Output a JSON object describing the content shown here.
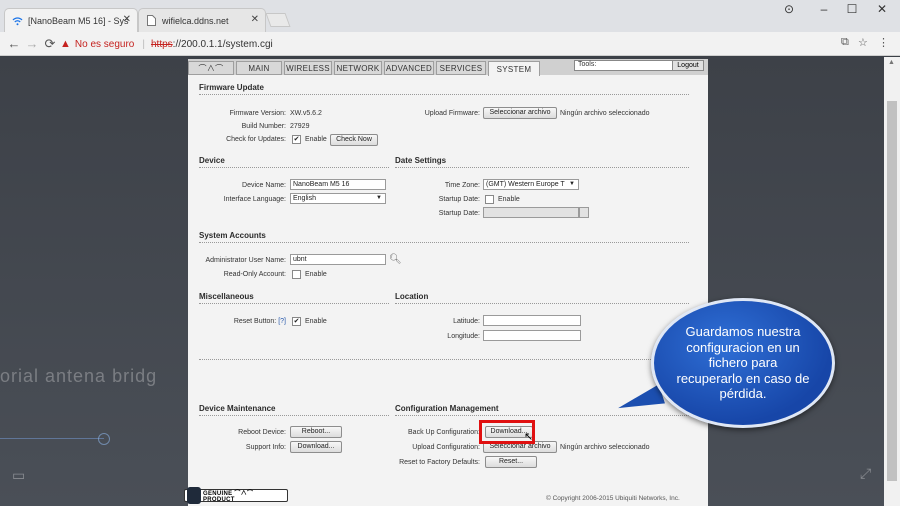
{
  "browser": {
    "tabs": [
      {
        "label": "[NanoBeam M5 16] - Sys",
        "icon": "wifi-icon"
      },
      {
        "label": "wifielca.ddns.net",
        "icon": "document-icon"
      }
    ],
    "window_controls": {
      "profile": "⊙",
      "minimize": "–",
      "maximize": "☐",
      "close": "✕"
    },
    "address": {
      "security_label": "No es seguro",
      "scheme": "https",
      "rest": "://200.0.1.1/system.cgi"
    }
  },
  "nav": {
    "logo": "⌒∧⌒",
    "tabs": [
      "MAIN",
      "WIRELESS",
      "NETWORK",
      "ADVANCED",
      "SERVICES",
      "SYSTEM"
    ],
    "active_tab": "SYSTEM",
    "tools_label": "Tools:",
    "logout_label": "Logout"
  },
  "firmware": {
    "title": "Firmware Update",
    "version_label": "Firmware Version:",
    "version": "XW.v5.6.2",
    "build_label": "Build Number:",
    "build": "27929",
    "check_label": "Check for Updates:",
    "check_enable": "Enable",
    "check_now": "Check Now",
    "upload_label": "Upload Firmware:",
    "upload_button": "Seleccionar archivo",
    "upload_status": "Ningún archivo seleccionado"
  },
  "device": {
    "title": "Device",
    "name_label": "Device Name:",
    "name": "NanoBeam M5 16",
    "lang_label": "Interface Language:",
    "lang": "English"
  },
  "date": {
    "title": "Date Settings",
    "tz_label": "Time Zone:",
    "tz": "(GMT) Western Europe T",
    "startup_label": "Startup Date:",
    "startup_enable": "Enable",
    "startup_date_label": "Startup Date:"
  },
  "accounts": {
    "title": "System Accounts",
    "admin_label": "Administrator User Name:",
    "admin": "ubnt",
    "ro_label": "Read-Only Account:",
    "ro_enable": "Enable"
  },
  "misc": {
    "title": "Miscellaneous",
    "reset_label": "Reset Button:",
    "reset_help": "[?]",
    "reset_enable": "Enable"
  },
  "location": {
    "title": "Location",
    "lat_label": "Latitude:",
    "lon_label": "Longitude:"
  },
  "maintenance": {
    "title": "Device Maintenance",
    "reboot_label": "Reboot Device:",
    "reboot_button": "Reboot...",
    "support_label": "Support Info:",
    "support_button": "Download..."
  },
  "config": {
    "title": "Configuration Management",
    "backup_label": "Back Up Configuration:",
    "backup_button": "Download...",
    "upload_label": "Upload Configuration:",
    "upload_button": "Seleccionar archivo",
    "upload_status": "Ningún archivo seleccionado",
    "reset_label": "Reset to Factory Defaults:",
    "reset_button": "Reset..."
  },
  "footer": {
    "badge": "GENUINE ⌒∧⌒ PRODUCT",
    "copyright": "© Copyright 2006-2015 Ubiquiti Networks, Inc."
  },
  "overlay": {
    "ghost_text": "torial antena bridg",
    "bubble": "Guardamos nuestra configuracion en un fichero para recuperarlo en caso de pérdida."
  },
  "colors": {
    "highlight": "#e01010",
    "bubble": "#1f55c0"
  }
}
